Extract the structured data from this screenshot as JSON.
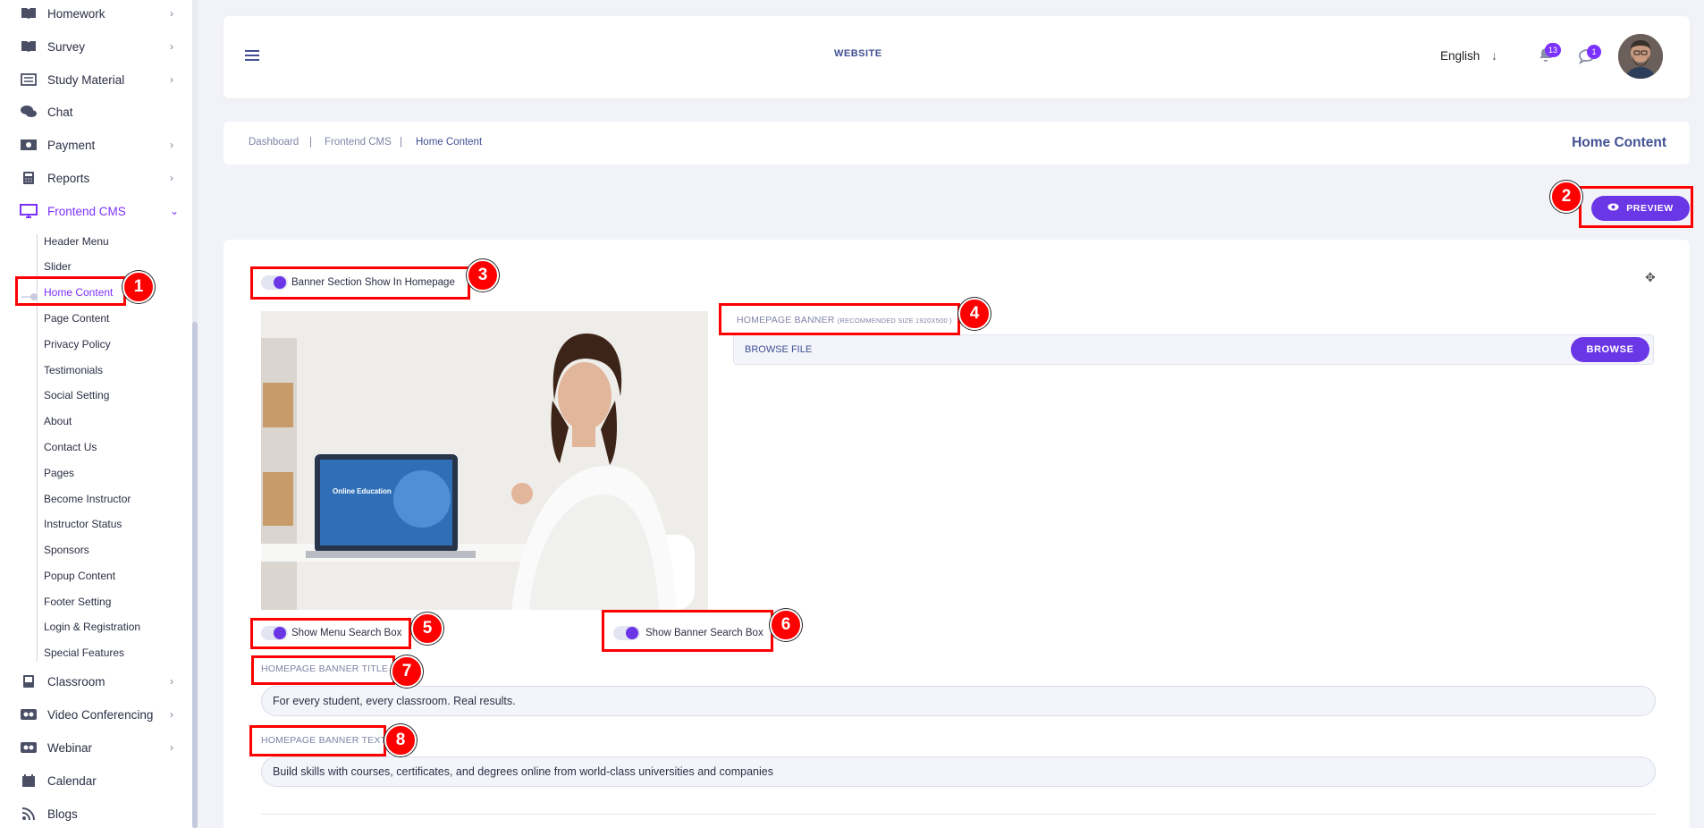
{
  "sidebar": {
    "items": [
      {
        "label": "Homework",
        "icon": "book-icon",
        "chevron": true
      },
      {
        "label": "Survey",
        "icon": "book-icon",
        "chevron": true
      },
      {
        "label": "Study Material",
        "icon": "list-icon",
        "chevron": true
      },
      {
        "label": "Chat",
        "icon": "chat-icon",
        "chevron": false
      },
      {
        "label": "Payment",
        "icon": "money-icon",
        "chevron": true
      },
      {
        "label": "Reports",
        "icon": "calculator-icon",
        "chevron": true
      },
      {
        "label": "Frontend CMS",
        "icon": "monitor-icon",
        "chevron": true,
        "expanded": true
      }
    ],
    "submenu": [
      "Header Menu",
      "Slider",
      "Home Content",
      "Page Content",
      "Privacy Policy",
      "Testimonials",
      "Social Setting",
      "About",
      "Contact Us",
      "Pages",
      "Become Instructor",
      "Instructor Status",
      "Sponsors",
      "Popup Content",
      "Footer Setting",
      "Login & Registration",
      "Special Features"
    ],
    "active_submenu": "Home Content",
    "items_after": [
      {
        "label": "Classroom",
        "icon": "classroom-icon",
        "chevron": true
      },
      {
        "label": "Video Conferencing",
        "icon": "video-icon",
        "chevron": true
      },
      {
        "label": "Webinar",
        "icon": "video-icon",
        "chevron": true
      },
      {
        "label": "Calendar",
        "icon": "calendar-icon",
        "chevron": false
      },
      {
        "label": "Blogs",
        "icon": "rss-icon",
        "chevron": false
      }
    ]
  },
  "topbar": {
    "website_link": "WEBSITE",
    "language": "English",
    "notification_count": "13",
    "message_count": "1"
  },
  "breadcrumb": {
    "items": [
      "Dashboard",
      "Frontend CMS",
      "Home Content"
    ],
    "separator": "|",
    "page_title": "Home Content"
  },
  "actions": {
    "preview_label": "PREVIEW"
  },
  "form": {
    "banner_toggle_label": "Banner Section Show In Homepage",
    "homepage_banner_label": "HOMEPAGE BANNER",
    "homepage_banner_hint": "(RECOMMENDED SIZE 1920X500 )",
    "file_placeholder": "BROWSE FILE",
    "browse_label": "BROWSE",
    "menu_search_toggle_label": "Show Menu Search Box",
    "banner_search_toggle_label": "Show Banner Search Box",
    "banner_title_label": "HOMEPAGE BANNER TITLE",
    "banner_title_value": "For every student, every classroom. Real results.",
    "banner_text_label": "HOMEPAGE BANNER TEXT",
    "banner_text_value": "Build skills with courses, certificates, and degrees online from world-class universities and companies",
    "banner_image_text": "Online Education"
  },
  "annotations": [
    "1",
    "2",
    "3",
    "4",
    "5",
    "6",
    "7",
    "8"
  ],
  "colors": {
    "accent": "#6b36e6",
    "text": "#415094",
    "annotation": "#ff0000"
  }
}
